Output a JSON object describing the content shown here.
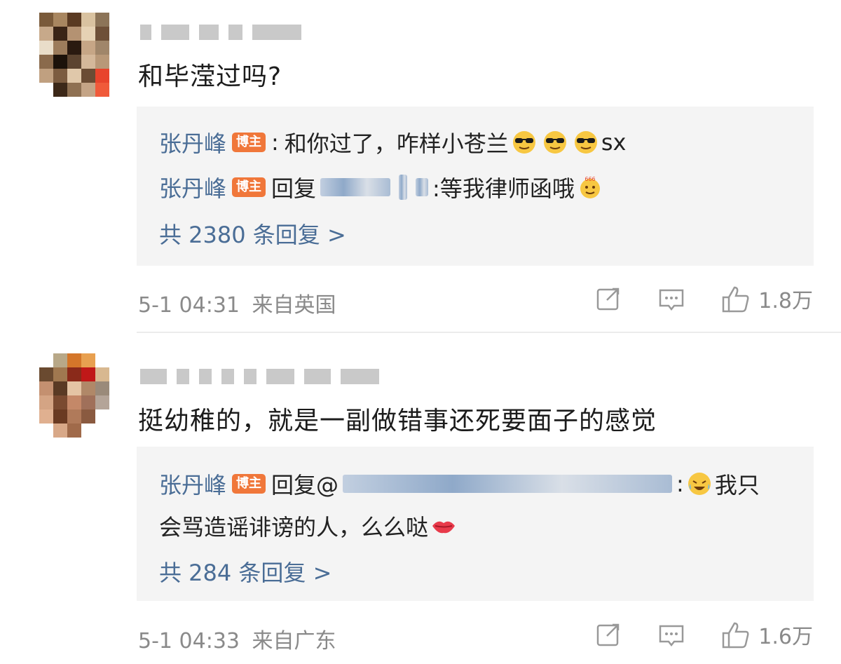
{
  "comments": [
    {
      "text": "和毕滢过吗?",
      "replies": [
        {
          "author": "张丹峰",
          "badge": "博主",
          "sep": ":",
          "text": "和你过了，咋样小苍兰",
          "suffix": "sx",
          "emoji": "sunglasses-emoji"
        },
        {
          "author": "张丹峰",
          "badge": "博主",
          "prefix": "回复",
          "tail": ":等我律师函哦",
          "emoji": "666-emoji"
        }
      ],
      "more": "共 2380 条回复 >",
      "time": "5-1 04:31",
      "source": "来自英国",
      "likes": "1.8万"
    },
    {
      "text": "挺幼稚的，就是一副做错事还死要面子的感觉",
      "replies": [
        {
          "author": "张丹峰",
          "badge": "博主",
          "prefix": "回复@",
          "tail": "我只",
          "line2": "会骂造谣诽谤的人，么么哒",
          "emoji": "laugh-cry-emoji",
          "emoji2": "kiss-lips-emoji"
        }
      ],
      "more": "共 284 条回复 >",
      "time": "5-1 04:33",
      "source": "来自广东",
      "likes": "1.6万"
    }
  ],
  "colors": {
    "link": "#4a6d96",
    "badge": "#f0773a",
    "meta": "#8a8a8a",
    "reply_bg": "#f4f4f4"
  }
}
